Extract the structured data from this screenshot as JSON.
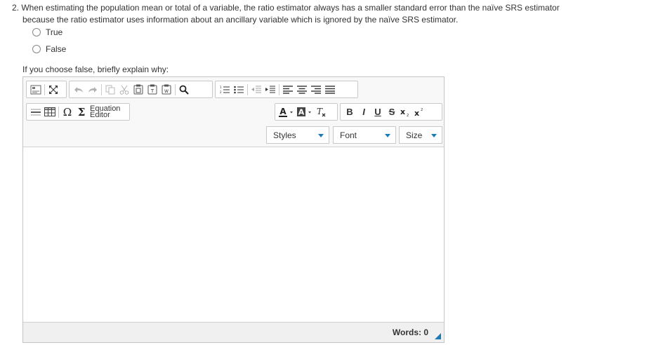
{
  "question": {
    "line1": "2. When estimating the population mean or total of a variable, the ratio estimator always has a smaller standard error than the naïve SRS estimator",
    "line2": "because the ratio estimator uses information about an ancillary variable which is ignored by the naïve SRS estimator.",
    "options": [
      "True",
      "False"
    ]
  },
  "prompt": "If you choose false, briefly explain why:",
  "editor": {
    "equation_line1": "Equation",
    "equation_line2": "Editor",
    "styles_label": "Styles",
    "font_label": "Font",
    "size_label": "Size",
    "word_count": "Words: 0",
    "format_labels": {
      "bold": "B",
      "italic": "I",
      "underline": "U",
      "strike": "S"
    },
    "icons": [
      "source-icon",
      "maximize-icon",
      "undo-icon",
      "redo-icon",
      "copy-icon",
      "cut-icon",
      "paste-icon",
      "paste-text-icon",
      "paste-word-icon",
      "find-icon",
      "numbered-list-icon",
      "bulleted-list-icon",
      "outdent-icon",
      "indent-icon",
      "align-left-icon",
      "align-center-icon",
      "align-right-icon",
      "justify-icon",
      "horizontal-rule-icon",
      "table-icon",
      "omega-icon",
      "sigma-icon",
      "text-color-icon",
      "background-color-icon",
      "remove-format-icon",
      "subscript-icon",
      "superscript-icon"
    ],
    "accent_color": "#1b7bb8"
  }
}
